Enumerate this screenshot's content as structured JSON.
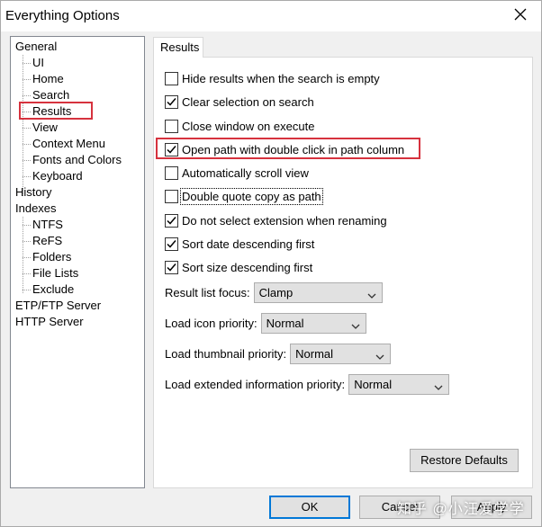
{
  "window": {
    "title": "Everything Options"
  },
  "tree": {
    "items": [
      {
        "label": "General"
      },
      {
        "label": "UI"
      },
      {
        "label": "Home"
      },
      {
        "label": "Search"
      },
      {
        "label": "Results"
      },
      {
        "label": "View"
      },
      {
        "label": "Context Menu"
      },
      {
        "label": "Fonts and Colors"
      },
      {
        "label": "Keyboard"
      },
      {
        "label": "History"
      },
      {
        "label": "Indexes"
      },
      {
        "label": "NTFS"
      },
      {
        "label": "ReFS"
      },
      {
        "label": "Folders"
      },
      {
        "label": "File Lists"
      },
      {
        "label": "Exclude"
      },
      {
        "label": "ETP/FTP Server"
      },
      {
        "label": "HTTP Server"
      }
    ],
    "selected": "Results"
  },
  "tab": {
    "label": "Results"
  },
  "options": [
    {
      "label": "Hide results when the search is empty",
      "checked": false
    },
    {
      "label": "Clear selection on search",
      "checked": true
    },
    {
      "label": "Close window on execute",
      "checked": false
    },
    {
      "label": "Open path with double click in path column",
      "checked": true
    },
    {
      "label": "Automatically scroll view",
      "checked": false
    },
    {
      "label": "Double quote copy as path",
      "checked": false
    },
    {
      "label": "Do not select extension when renaming",
      "checked": true
    },
    {
      "label": "Sort date descending first",
      "checked": true
    },
    {
      "label": "Sort size descending first",
      "checked": true
    }
  ],
  "dropdowns": [
    {
      "label": "Result list focus:",
      "value": "Clamp"
    },
    {
      "label": "Load icon priority:",
      "value": "Normal"
    },
    {
      "label": "Load thumbnail priority:",
      "value": "Normal"
    },
    {
      "label": "Load extended information priority:",
      "value": "Normal"
    }
  ],
  "buttons": {
    "restore_defaults": "Restore Defaults",
    "ok": "OK",
    "cancel": "Cancel",
    "apply": "Apply"
  },
  "watermark": "知乎 @小汪爱学学"
}
